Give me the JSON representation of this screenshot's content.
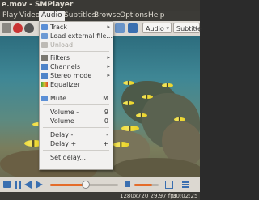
{
  "window": {
    "title": "e.mov - SMPlayer"
  },
  "menubar": {
    "items": [
      "Play",
      "Video",
      "Audio",
      "Subtitles",
      "Browse",
      "Options",
      "Help"
    ],
    "active": "Audio"
  },
  "toolbar": {
    "audio_combo": "Audio",
    "subtitle_combo": "Subtitle"
  },
  "audio_menu": {
    "track": "Track",
    "load_external": "Load external file...",
    "unload": "Unload",
    "filters": "Filters",
    "channels": "Channels",
    "stereo_mode": "Stereo mode",
    "equalizer": "Equalizer",
    "mute": {
      "label": "Mute",
      "shortcut": "M"
    },
    "volume_down": {
      "label": "Volume -",
      "shortcut": "9"
    },
    "volume_up": {
      "label": "Volume +",
      "shortcut": "0"
    },
    "delay_down": {
      "label": "Delay -",
      "shortcut": "-"
    },
    "delay_up": {
      "label": "Delay +",
      "shortcut": "+"
    },
    "set_delay": "Set delay..."
  },
  "playback": {
    "progress": 0.52
  },
  "status": {
    "resolution": "1280x720 29.97 fps",
    "time": "00:02:25"
  },
  "colors": {
    "accent": "#e46c2a",
    "menubar": "#3c3b37"
  }
}
